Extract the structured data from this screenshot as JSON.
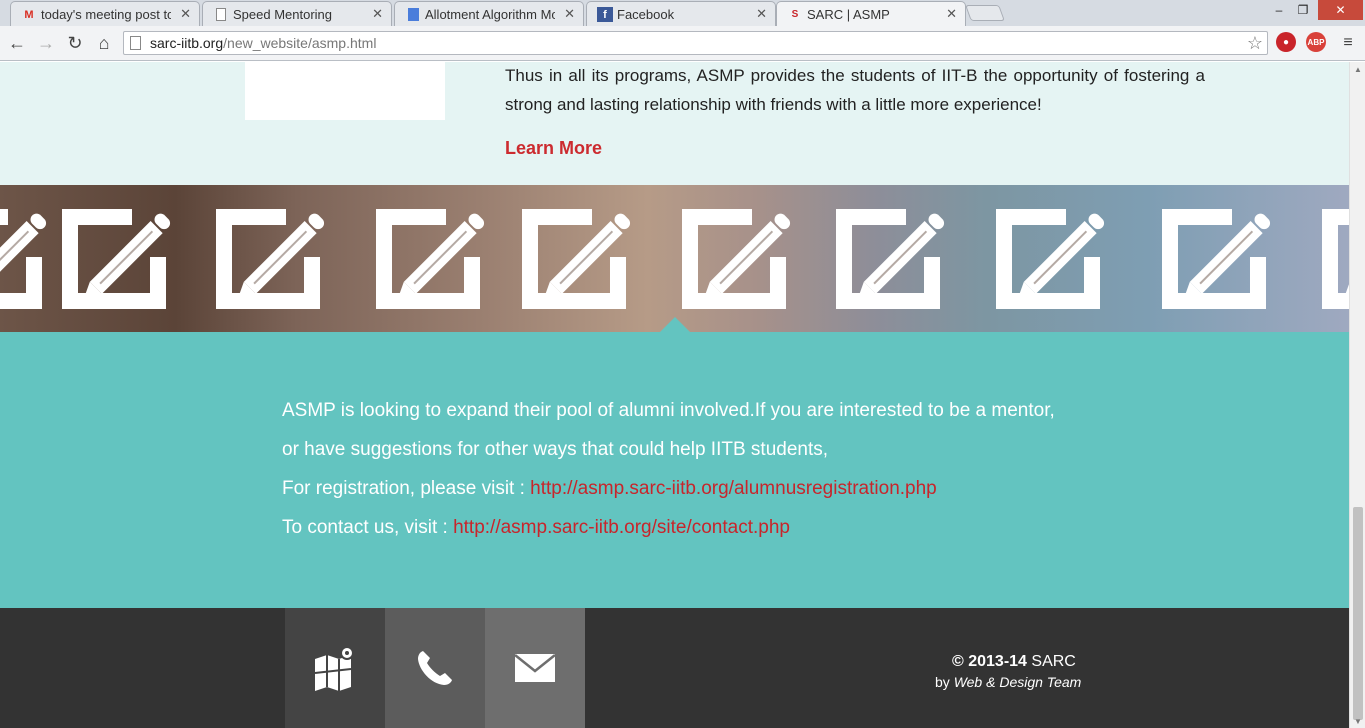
{
  "browser": {
    "tabs": [
      {
        "label": "today's meeting post to to",
        "icon": "gmail-icon",
        "active": false
      },
      {
        "label": "Speed Mentoring",
        "icon": "page-icon",
        "active": false
      },
      {
        "label": "Allotment Algorithm Moc",
        "icon": "docs-icon",
        "active": false
      },
      {
        "label": "Facebook",
        "icon": "facebook-icon",
        "active": false
      },
      {
        "label": "SARC | ASMP",
        "icon": "sarc-icon",
        "active": true
      }
    ],
    "url_host": "sarc-iitb.org",
    "url_path": "/new_website/asmp.html",
    "extensions": [
      {
        "name": "adblock-icon",
        "text": "ABP",
        "color": "#d9413a"
      },
      {
        "name": "stop-icon",
        "text": "●",
        "color": "#c9242a"
      }
    ]
  },
  "intro": {
    "paragraph": "Thus in all its programs, ASMP provides the students of IIT-B the opportunity of fostering a strong and lasting relationship with friends with a little more experience!",
    "learn_more": "Learn More"
  },
  "banner": {
    "icon": "edit-icon",
    "icon_count": 9
  },
  "cta": {
    "line1": "ASMP is looking to expand their pool of alumni involved.If you are interested to be a mentor,",
    "line2": "or have suggestions for other ways that could help IITB students,",
    "registration_prefix": "For registration, please visit :",
    "registration_link": "http://asmp.sarc-iitb.org/alumnusregistration.php",
    "contact_prefix": "To contact us, visit :",
    "contact_link": "http://asmp.sarc-iitb.org/site/contact.php"
  },
  "footer": {
    "buttons": [
      {
        "name": "map-icon",
        "color": "#444444"
      },
      {
        "name": "phone-icon",
        "color": "#5c5c5c"
      },
      {
        "name": "mail-icon",
        "color": "#6e6e6e"
      }
    ],
    "copyright_years": "© 2013-14",
    "copyright_org": "SARC",
    "credit_prefix": "by",
    "credit_team": "Web & Design Team"
  },
  "colors": {
    "accent_red": "#cc2b2f",
    "teal": "#63c4c0",
    "footer_bg": "#333333"
  }
}
